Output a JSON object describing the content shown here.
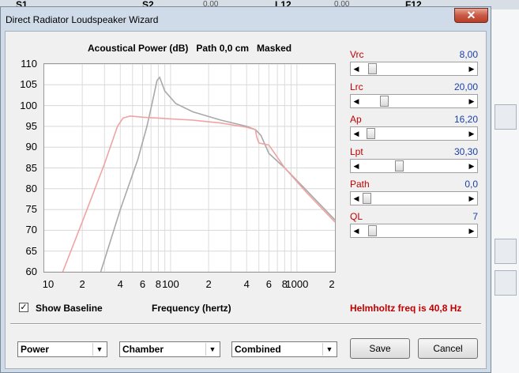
{
  "background": {
    "columns": [
      {
        "label": "S1",
        "x": 20
      },
      {
        "label": "S2",
        "x": 180
      },
      {
        "label": "L12",
        "x": 348
      },
      {
        "label": "F12",
        "x": 513
      }
    ],
    "cells": [
      {
        "text": "0.00",
        "x": 257
      },
      {
        "text": "0.00",
        "x": 423
      }
    ]
  },
  "window": {
    "title": "Direct Radiator Loudspeaker Wizard",
    "close_glyph": "✕"
  },
  "chart_data": {
    "type": "line",
    "title": "Acoustical Power (dB)   Path 0,0 cm   Masked",
    "xlabel": "Frequency (hertz)",
    "ylabel": "",
    "x_scale": "log",
    "xlim": [
      10,
      2000
    ],
    "ylim": [
      60,
      110
    ],
    "y_ticks": [
      "60",
      "65",
      "70",
      "75",
      "80",
      "85",
      "90",
      "95",
      "100",
      "105",
      "110"
    ],
    "x_ticks": [
      {
        "label": "10",
        "value": 10
      },
      {
        "label": "2",
        "value": 20
      },
      {
        "label": "4",
        "value": 40
      },
      {
        "label": "6",
        "value": 60
      },
      {
        "label": "8",
        "value": 80
      },
      {
        "label": "100",
        "value": 100
      },
      {
        "label": "2",
        "value": 200
      },
      {
        "label": "4",
        "value": 400
      },
      {
        "label": "6",
        "value": 600
      },
      {
        "label": "8",
        "value": 800
      },
      {
        "label": "1000",
        "value": 1000
      },
      {
        "label": "2",
        "value": 2000
      }
    ],
    "grid": true,
    "series": [
      {
        "color": "#a9a9a9",
        "x": [
          28,
          40,
          55,
          65,
          72,
          78,
          82,
          90,
          110,
          150,
          250,
          400,
          470,
          520,
          600,
          800,
          1200,
          2000
        ],
        "y": [
          60,
          75,
          87,
          95,
          101,
          106,
          106.8,
          103.5,
          100.5,
          98.5,
          96.5,
          95,
          94.2,
          92.8,
          88.5,
          85,
          79.5,
          72.5
        ]
      },
      {
        "color": "#f0a3a3",
        "x": [
          14,
          20,
          30,
          38,
          42,
          48,
          60,
          80,
          100,
          150,
          250,
          400,
          470,
          480,
          500,
          600,
          800,
          1200,
          2000
        ],
        "y": [
          60,
          72,
          86,
          95,
          97,
          97.5,
          97.2,
          97,
          96.8,
          96.5,
          95.8,
          94.8,
          94.2,
          92.5,
          91,
          90.5,
          85,
          79,
          72
        ]
      }
    ]
  },
  "controls": [
    {
      "name": "Vrc",
      "value": "8,00",
      "thumb": 0.06
    },
    {
      "name": "Lrc",
      "value": "20,00",
      "thumb": 0.18
    },
    {
      "name": "Ap",
      "value": "16,20",
      "thumb": 0.04
    },
    {
      "name": "Lpt",
      "value": "30,30",
      "thumb": 0.34
    },
    {
      "name": "Path",
      "value": "0,0",
      "thumb": 0.0
    },
    {
      "name": "QL",
      "value": "7",
      "thumb": 0.06
    }
  ],
  "show_baseline": {
    "label": "Show Baseline",
    "checked": true
  },
  "helmholtz": "Helmholtz freq is 40,8 Hz",
  "combos": [
    {
      "value": "Power"
    },
    {
      "value": "Chamber"
    },
    {
      "value": "Combined"
    }
  ],
  "buttons": {
    "save": "Save",
    "cancel": "Cancel"
  }
}
